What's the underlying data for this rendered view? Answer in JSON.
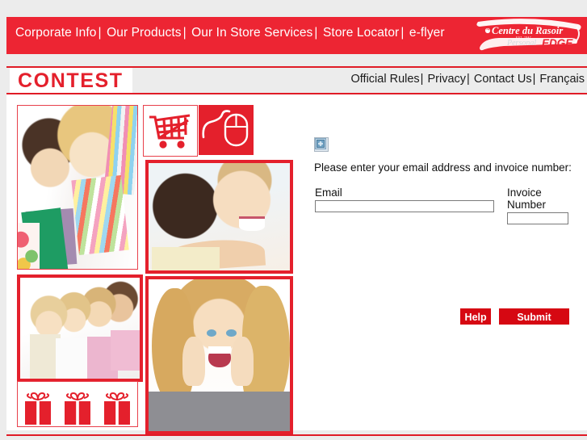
{
  "nav": {
    "items": [
      "Corporate Info",
      "Our Products",
      "Our In Store Services",
      "Store Locator",
      "e-flyer"
    ],
    "separator": "|"
  },
  "logo": {
    "brand_top": "Centre du Rasoir",
    "brand_bottom_script": "Personal",
    "brand_bottom_bold": "EDGE",
    "color": "#ed2533"
  },
  "header": {
    "title": "CONTEST",
    "title_color": "#e4202c",
    "links": [
      "Official Rules",
      "Privacy",
      "Contact Us",
      "Français"
    ],
    "separator": "|"
  },
  "form": {
    "missing_image_icon": "broken-image-icon",
    "instruction": "Please enter your email address and invoice number:",
    "email_label": "Email",
    "email_value": "",
    "email_placeholder": "",
    "invoice_label": "Invoice Number",
    "invoice_value": "",
    "invoice_placeholder": "",
    "help_label": "Help",
    "submit_label": "Submit",
    "button_color": "#d60812"
  },
  "collage": {
    "tiles": [
      {
        "name": "couple-shopping-photo",
        "alt": "Smiling couple carrying shopping bags"
      },
      {
        "name": "shopping-cart-icon-tile",
        "alt": "Red shopping cart icon on white"
      },
      {
        "name": "computer-mouse-icon-tile",
        "alt": "White computer mouse icon on red"
      },
      {
        "name": "couple-embrace-photo",
        "alt": "Laughing woman embracing a man"
      },
      {
        "name": "family-photo",
        "alt": "Family of four smiling together"
      },
      {
        "name": "surprised-woman-photo",
        "alt": "Surprised blonde woman with hands on cheeks"
      },
      {
        "name": "gift-boxes-tile",
        "alt": "Three red gift boxes with ribbon bows"
      }
    ],
    "border_color": "#e4202c",
    "gift_count": 3
  },
  "theme": {
    "page_background": "#ececec",
    "content_background": "#ffffff",
    "brand_red": "#ed2533",
    "rule_red": "#e01b26"
  }
}
